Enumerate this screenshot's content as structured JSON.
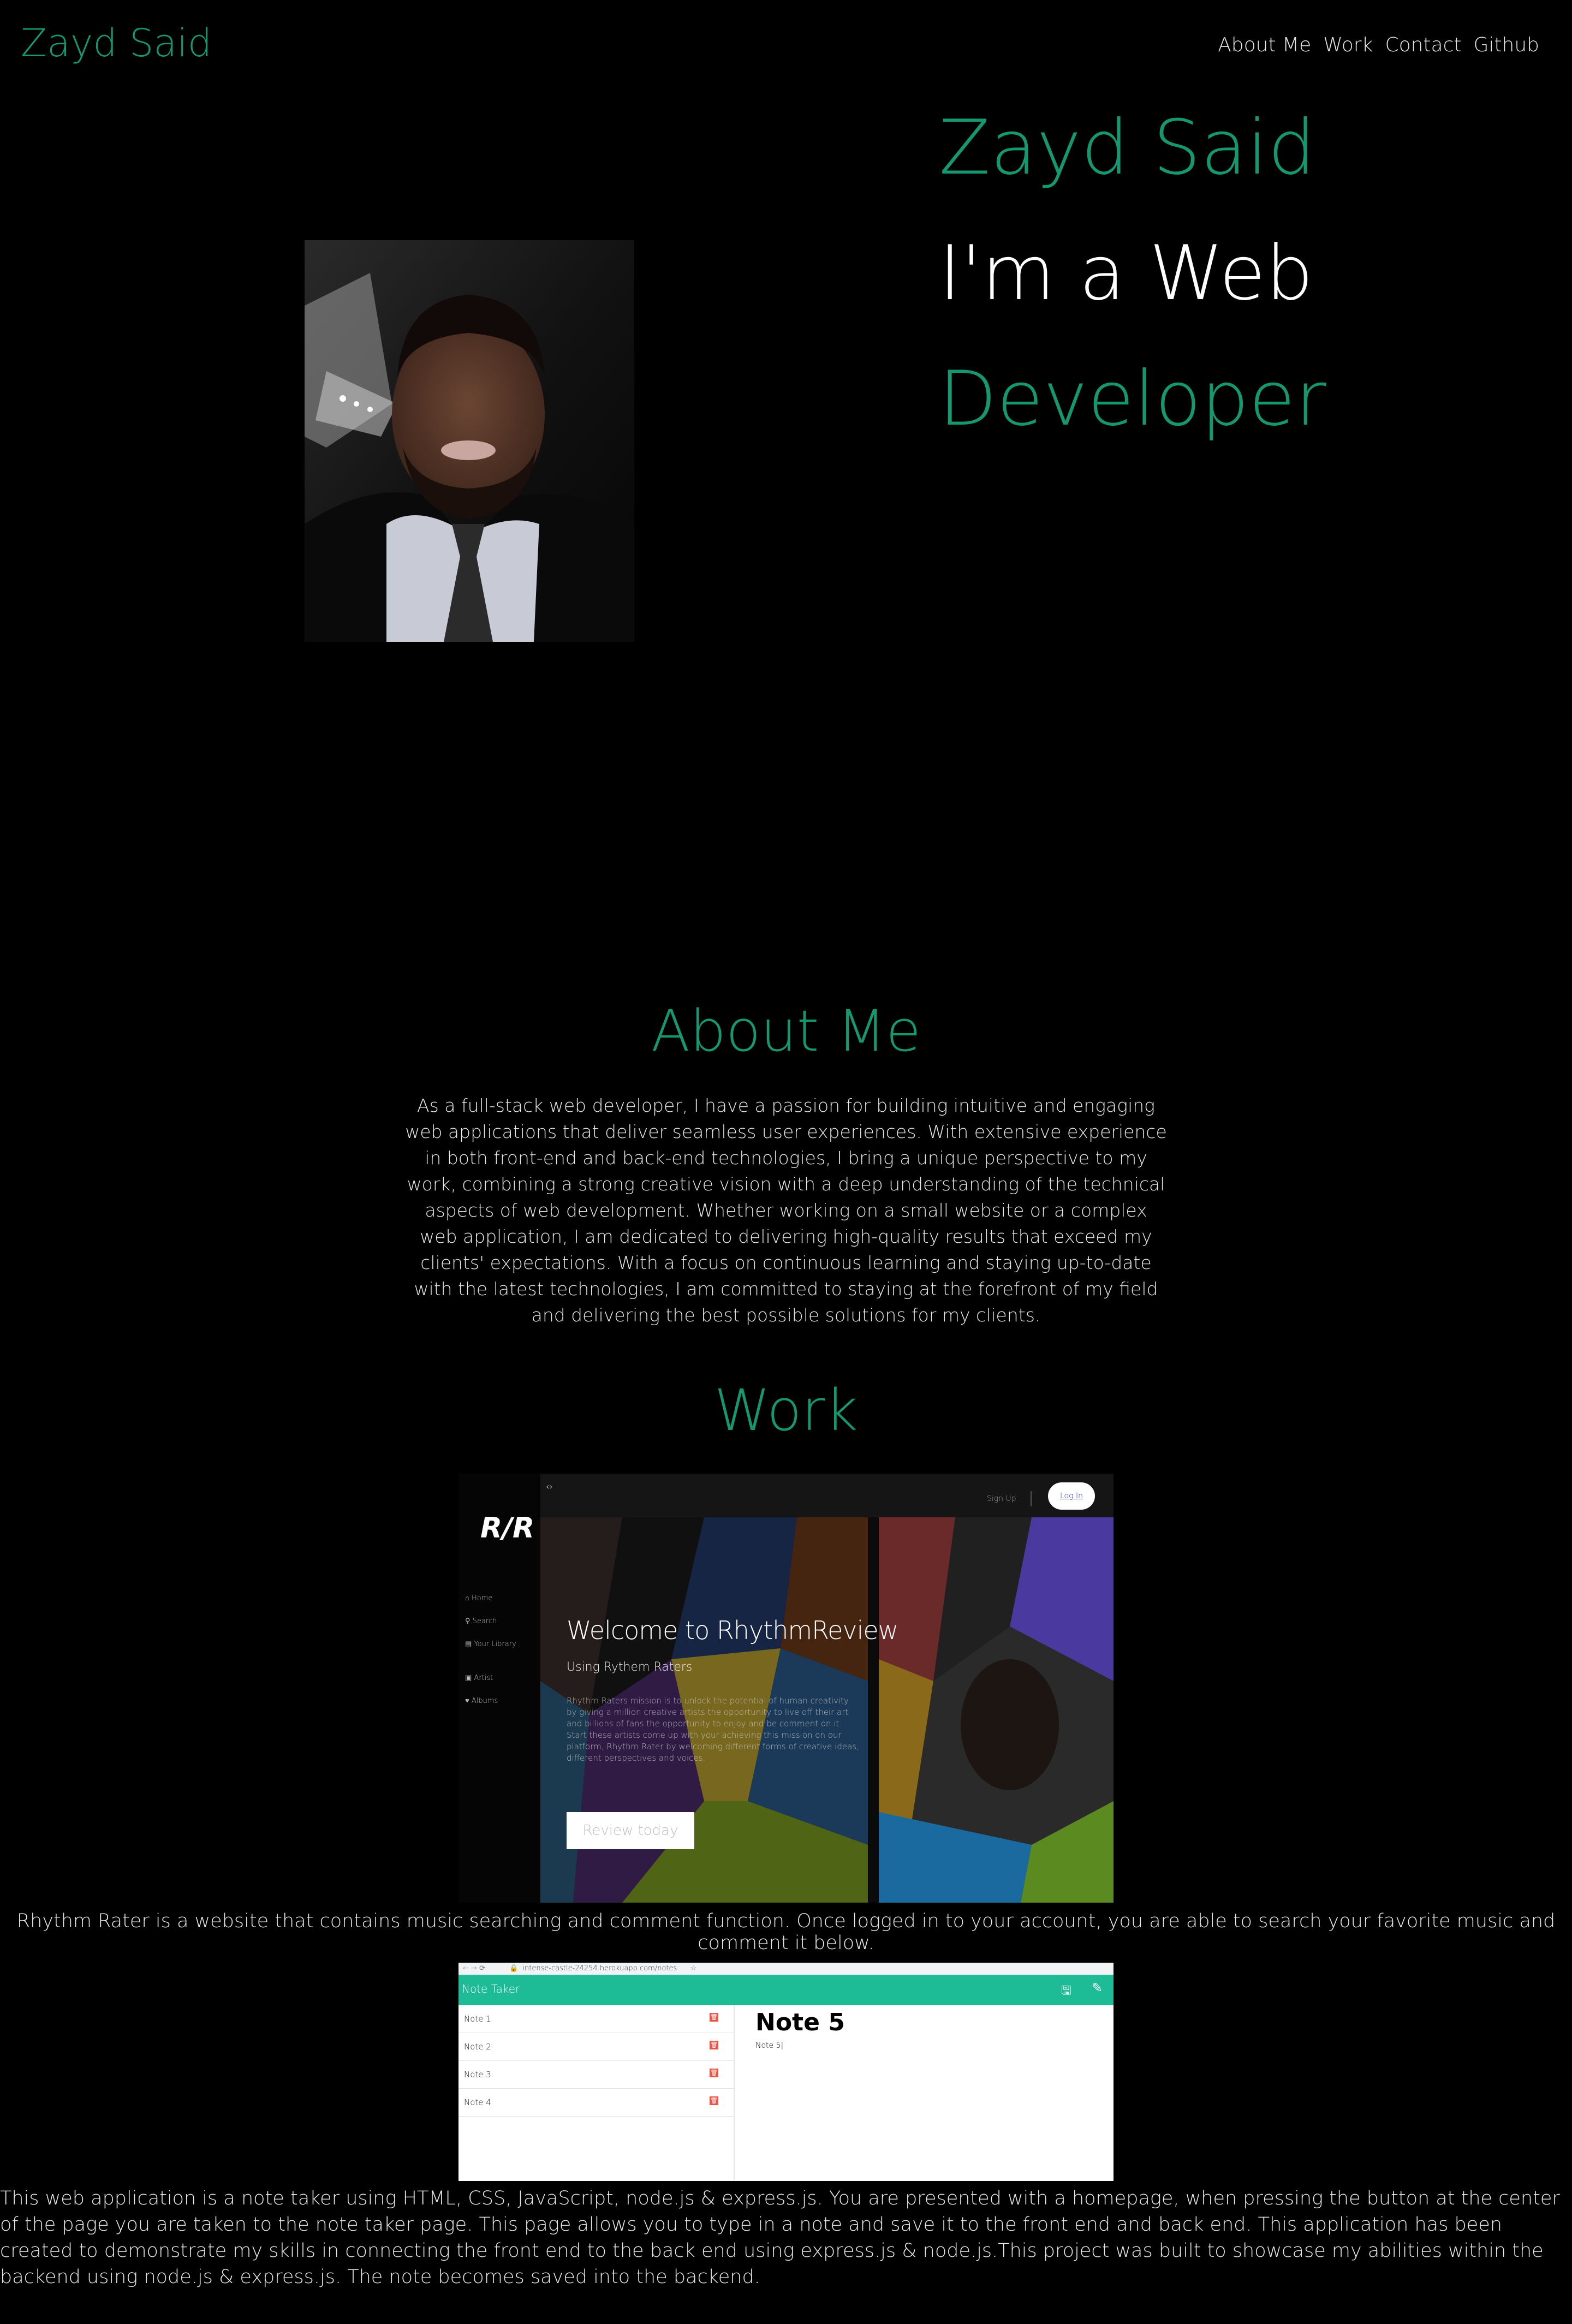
{
  "header": {
    "brand": "Zayd Said",
    "nav": [
      "About Me",
      "Work",
      "Contact",
      "Github"
    ]
  },
  "hero": {
    "name": "Zayd Said",
    "line1": "I'm a Web",
    "line2": "Developer"
  },
  "about": {
    "title": "About Me",
    "text": "As a full-stack web developer, I have a passion for building intuitive and engaging web applications that deliver seamless user experiences. With extensive experience in both front-end and back-end technologies, I bring a unique perspective to my work, combining a strong creative vision with a deep understanding of the technical aspects of web development. Whether working on a small website or a complex web application, I am dedicated to delivering high-quality results that exceed my clients' expectations. With a focus on continuous learning and staying up-to-date with the latest technologies, I am committed to staying at the forefront of my field and delivering the best possible solutions for my clients."
  },
  "work": {
    "title": "Work",
    "project1": {
      "app": {
        "logo": "R/R",
        "sidebar": [
          "Home",
          "Search",
          "Your Library",
          "Artist",
          "Albums"
        ],
        "signup": "Sign Up",
        "login": "Log In",
        "welcome": "Welcome to RhythmReview",
        "subtitle": "Using Rythem Raters",
        "body": "Rhythm Raters mission is to unlock the potential of human creativity by giving a million creative artists the opportunity to live off their art and billions of fans the opportunity to enjoy and be comment on it. Start these artists come up with your achieving this mission on our platform, Rhythm Rater by welcoming different forms of creative ideas, different perspectives and voices.",
        "cta": "Review today"
      },
      "caption": "Rhythm Rater is a website that contains music searching and comment function. Once logged in to your account, you are able to search your favorite music and comment it below."
    },
    "project2": {
      "app": {
        "url": "intense-castle-24254.herokuapp.com/notes",
        "title": "Note Taker",
        "notes": [
          "Note 1",
          "Note 2",
          "Note 3",
          "Note 4"
        ],
        "active_title": "Note 5",
        "active_text": "Note 5|"
      },
      "caption": "This web application is a note taker using HTML, CSS, JavaScript, node.js & express.js. You are presented with a homepage, when pressing the button at the center of the page you are taken to the note taker page. This page allows you to type in a note and save it to the front end and back end. This application has been created to demonstrate my skills in connecting the front end to the back end using express.js & node.js.This project was built to showcase my abilities within the backend using node.js & express.js. The note becomes saved into the backend."
    }
  },
  "colors": {
    "accent": "#159870",
    "note_header": "#1ebc96",
    "background": "#000000"
  }
}
